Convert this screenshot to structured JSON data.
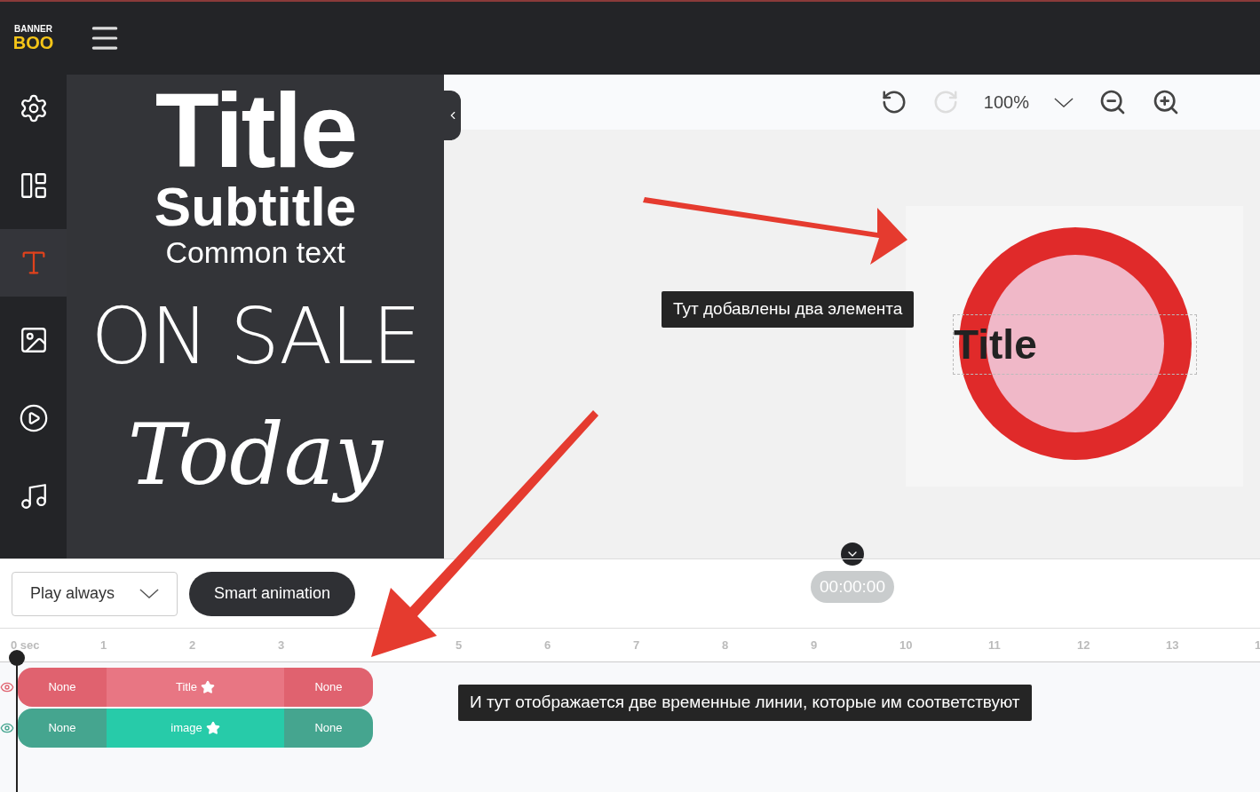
{
  "header": {
    "logo_top": "BANNER",
    "logo_bottom": "BOO"
  },
  "sidebar": {
    "items": [
      {
        "kind": "settings",
        "selected": false
      },
      {
        "kind": "layout",
        "selected": false
      },
      {
        "kind": "text",
        "selected": true
      },
      {
        "kind": "image",
        "selected": false
      },
      {
        "kind": "video",
        "selected": false
      },
      {
        "kind": "music",
        "selected": false
      }
    ]
  },
  "text_presets": [
    {
      "kind": "title",
      "label": "Title"
    },
    {
      "kind": "subtitle",
      "label": "Subtitle"
    },
    {
      "kind": "body",
      "label": "Common text"
    },
    {
      "kind": "display",
      "label": "ON SALE"
    },
    {
      "kind": "script",
      "label": "Today"
    }
  ],
  "toolbar": {
    "undo": {
      "disabled": false
    },
    "redo": {
      "disabled": true
    },
    "zoom": "100%"
  },
  "canvas": {
    "element_text": "Title"
  },
  "annotations": [
    "Тут добавлены два элемента",
    "И тут отображается две временные линии, которые им соответствуют"
  ],
  "timeline": {
    "play_mode": "Play always",
    "smart_button": "Smart animation",
    "time": "00:00:00",
    "ruler": [
      "0 sec",
      "1",
      "2",
      "3",
      "5",
      "6",
      "7",
      "8",
      "9",
      "10",
      "11",
      "12",
      "13",
      "1"
    ],
    "tracks": [
      {
        "color": "#e0626f",
        "segments": [
          {
            "kind": "start",
            "label": "None",
            "color": "#e0626f"
          },
          {
            "kind": "main",
            "label": "Title",
            "color": "#e87683"
          },
          {
            "kind": "end",
            "label": "None",
            "color": "#e0626f"
          }
        ]
      },
      {
        "color": "#45a58f",
        "segments": [
          {
            "kind": "start",
            "label": "None",
            "color": "#45a58f"
          },
          {
            "kind": "main",
            "label": "image",
            "color": "#27cba9"
          },
          {
            "kind": "end",
            "label": "None",
            "color": "#45a58f"
          }
        ]
      }
    ]
  }
}
